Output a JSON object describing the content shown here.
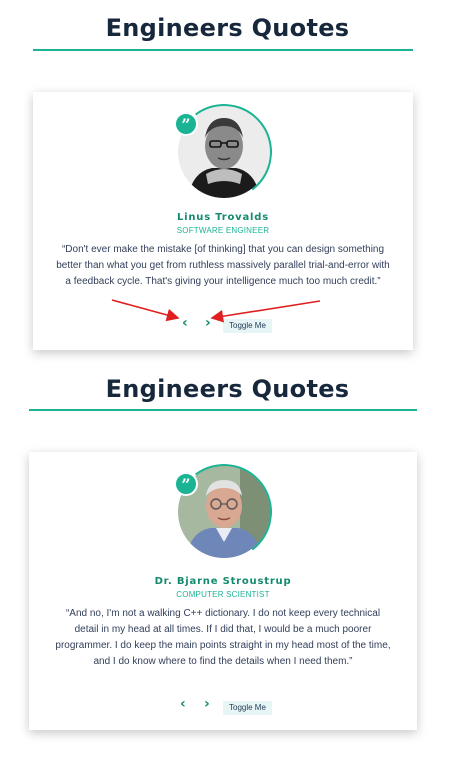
{
  "sections": [
    {
      "title": "Engineers Quotes",
      "card": {
        "quote_mark": "”",
        "name": "Linus Trovalds",
        "role": "SOFTWARE ENGINEER",
        "quote": "“Don't ever make the mistake [of thinking] that you can design something better than what you get from ruthless massively parallel trial-and-error with a feedback cycle. That's giving your intelligence much too much credit.”",
        "prev_label": "‹",
        "next_label": "›",
        "toggle_label": "Toggle Me"
      }
    },
    {
      "title": "Engineers Quotes",
      "card": {
        "quote_mark": "”",
        "name": "Dr. Bjarne Stroustrup",
        "role": "COMPUTER SCIENTIST",
        "quote": "“And no, I'm not a walking C++ dictionary. I do not keep every technical detail in my head at all times. If I did that, I would be a much poorer programmer. I do keep the main points straight in my head most of the time, and I do know where to find the details when I need them.”",
        "prev_label": "‹",
        "next_label": "›",
        "toggle_label": "Toggle Me"
      }
    }
  ],
  "colors": {
    "accent": "#1ab394",
    "title": "#17283d",
    "annotation_arrow": "#e02020"
  }
}
